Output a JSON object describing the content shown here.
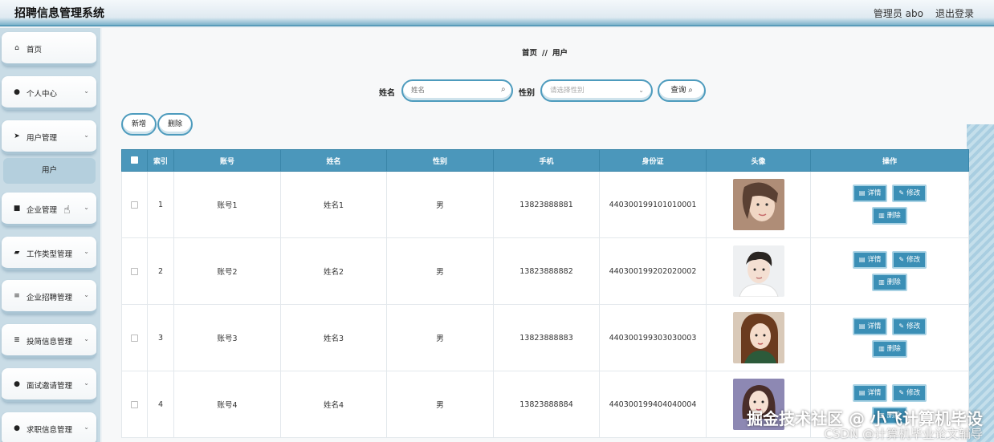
{
  "header": {
    "title": "招聘信息管理系统",
    "admin": "管理员 abo",
    "logout": "退出登录"
  },
  "sidebar": {
    "items": [
      {
        "label": "首页",
        "icon": "home-icon",
        "glyph": "⌂",
        "chevron": false
      },
      {
        "label": "个人中心",
        "icon": "user-icon",
        "glyph": "●",
        "chevron": true
      },
      {
        "label": "用户管理",
        "icon": "send-icon",
        "glyph": "➤",
        "chevron": true
      },
      {
        "label": "企业管理",
        "icon": "grid-icon",
        "glyph": "■",
        "chevron": true
      },
      {
        "label": "工作类型管理",
        "icon": "chat-icon",
        "glyph": "▰",
        "chevron": true
      },
      {
        "label": "企业招聘管理",
        "icon": "sliders-icon",
        "glyph": "≡",
        "chevron": true
      },
      {
        "label": "投简信息管理",
        "icon": "list-icon",
        "glyph": "≣",
        "chevron": true
      },
      {
        "label": "面试邀请管理",
        "icon": "pin-icon",
        "glyph": "●",
        "chevron": true
      },
      {
        "label": "求职信息管理",
        "icon": "user-icon",
        "glyph": "●",
        "chevron": true
      }
    ],
    "submenu": "用户"
  },
  "breadcrumb": {
    "home": "首页",
    "sep": "//",
    "current": "用户"
  },
  "search": {
    "name_label": "姓名",
    "name_placeholder": "姓名",
    "gender_label": "性别",
    "gender_placeholder": "请选择性别",
    "query": "查询"
  },
  "actions": {
    "add": "新增",
    "delete": "删除"
  },
  "table": {
    "headers": [
      "索引",
      "账号",
      "姓名",
      "性别",
      "手机",
      "身份证",
      "头像",
      "操作"
    ],
    "rows": [
      {
        "index": "1",
        "account": "账号1",
        "name": "姓名1",
        "gender": "男",
        "phone": "13823888881",
        "idcard": "440300199101010001"
      },
      {
        "index": "2",
        "account": "账号2",
        "name": "姓名2",
        "gender": "男",
        "phone": "13823888882",
        "idcard": "440300199202020002"
      },
      {
        "index": "3",
        "account": "账号3",
        "name": "姓名3",
        "gender": "男",
        "phone": "13823888883",
        "idcard": "440300199303030003"
      },
      {
        "index": "4",
        "account": "账号4",
        "name": "姓名4",
        "gender": "男",
        "phone": "13823888884",
        "idcard": "440300199404040004"
      }
    ],
    "op_detail": "详情",
    "op_edit": "修改",
    "op_delete": "删除"
  },
  "watermark": {
    "line1": "掘金技术社区 @ 小飞计算机毕设",
    "line2": "CSDN @计算机毕业论文辅导"
  },
  "colors": {
    "accent": "#4b97bb",
    "sidebar": "#c9dce6"
  }
}
